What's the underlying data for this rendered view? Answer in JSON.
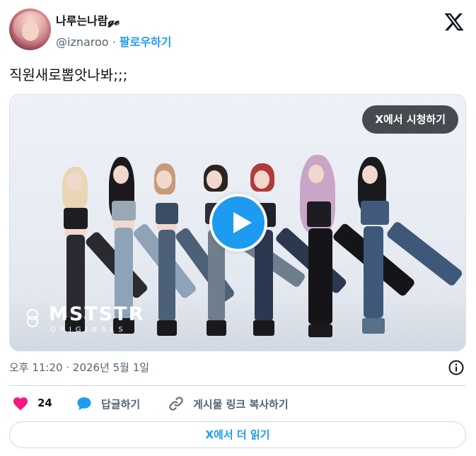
{
  "author": {
    "display_name": "나루는나람𝓰𝓮",
    "handle": "@iznaroo",
    "separator": "·",
    "follow_label": "팔로우하기"
  },
  "brand": {
    "icon": "x-logo-icon"
  },
  "tweet": {
    "text": "직원새로뽑앗나봐;;;"
  },
  "media": {
    "watch_label": "X에서 시청하기",
    "play_icon": "play-icon",
    "watermark_title": "MSTSTR",
    "watermark_sub": "ORIGINALS"
  },
  "meta": {
    "timestamp": "오후 11:20 · 2026년 5월 1일",
    "info_icon": "info-icon"
  },
  "actions": {
    "like_count": "24",
    "reply_label": "답글하기",
    "copy_link_label": "게시물 링크 복사하기"
  },
  "footer": {
    "read_more_label": "X에서 더 읽기"
  },
  "colors": {
    "accent": "#1d9bf0",
    "like": "#f91880",
    "text": "#0f1419",
    "muted": "#536471",
    "border": "#cfd9de"
  }
}
